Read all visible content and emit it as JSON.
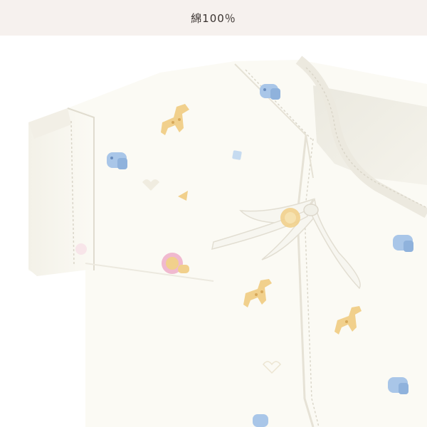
{
  "caption": {
    "text": "綿100％"
  },
  "photo": {
    "subject": "kimono-style-baby-undershirt",
    "colors": {
      "fabric": "#fbfaf4",
      "fabric_shadow": "#ece9df",
      "stitch": "#d9d5c8",
      "print_blue": "#a9c6e8",
      "print_yellow": "#f1d08c",
      "print_pink": "#f0b9cf",
      "background": "#ffffff",
      "caption_bar": "#f6f1ee"
    }
  }
}
